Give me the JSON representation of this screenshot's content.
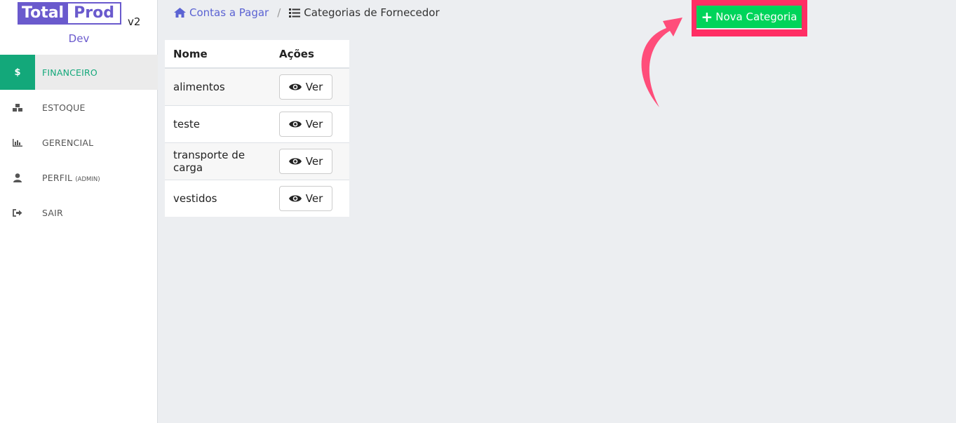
{
  "logo": {
    "part1": "Total",
    "part2": "Prod",
    "version": "v2",
    "env": "Dev"
  },
  "sidebar": {
    "items": [
      {
        "icon": "dollar-icon",
        "label": "FINANCEIRO",
        "sub": "",
        "active": true
      },
      {
        "icon": "boxes-icon",
        "label": "ESTOQUE",
        "sub": ""
      },
      {
        "icon": "bar-chart-icon",
        "label": "GERENCIAL",
        "sub": ""
      },
      {
        "icon": "user-icon",
        "label": "PERFIL",
        "sub": "(ADMIN)"
      },
      {
        "icon": "sign-out-icon",
        "label": "SAIR",
        "sub": ""
      }
    ]
  },
  "breadcrumb": {
    "home_label": "Contas a Pagar",
    "current_label": "Categorias de Fornecedor"
  },
  "table": {
    "headers": [
      "Nome",
      "Ações"
    ],
    "rows": [
      {
        "nome": "alimentos",
        "action": "Ver"
      },
      {
        "nome": "teste",
        "action": "Ver"
      },
      {
        "nome": "transporte de carga",
        "action": "Ver"
      },
      {
        "nome": "vestidos",
        "action": "Ver"
      }
    ]
  },
  "actions": {
    "new_category_label": "Nova Categoria"
  },
  "colors": {
    "accent": "#13a87a",
    "brand": "#6a5acd",
    "highlight": "#ff2e64",
    "button_green": "#00d45a",
    "link": "#5b63d3"
  }
}
